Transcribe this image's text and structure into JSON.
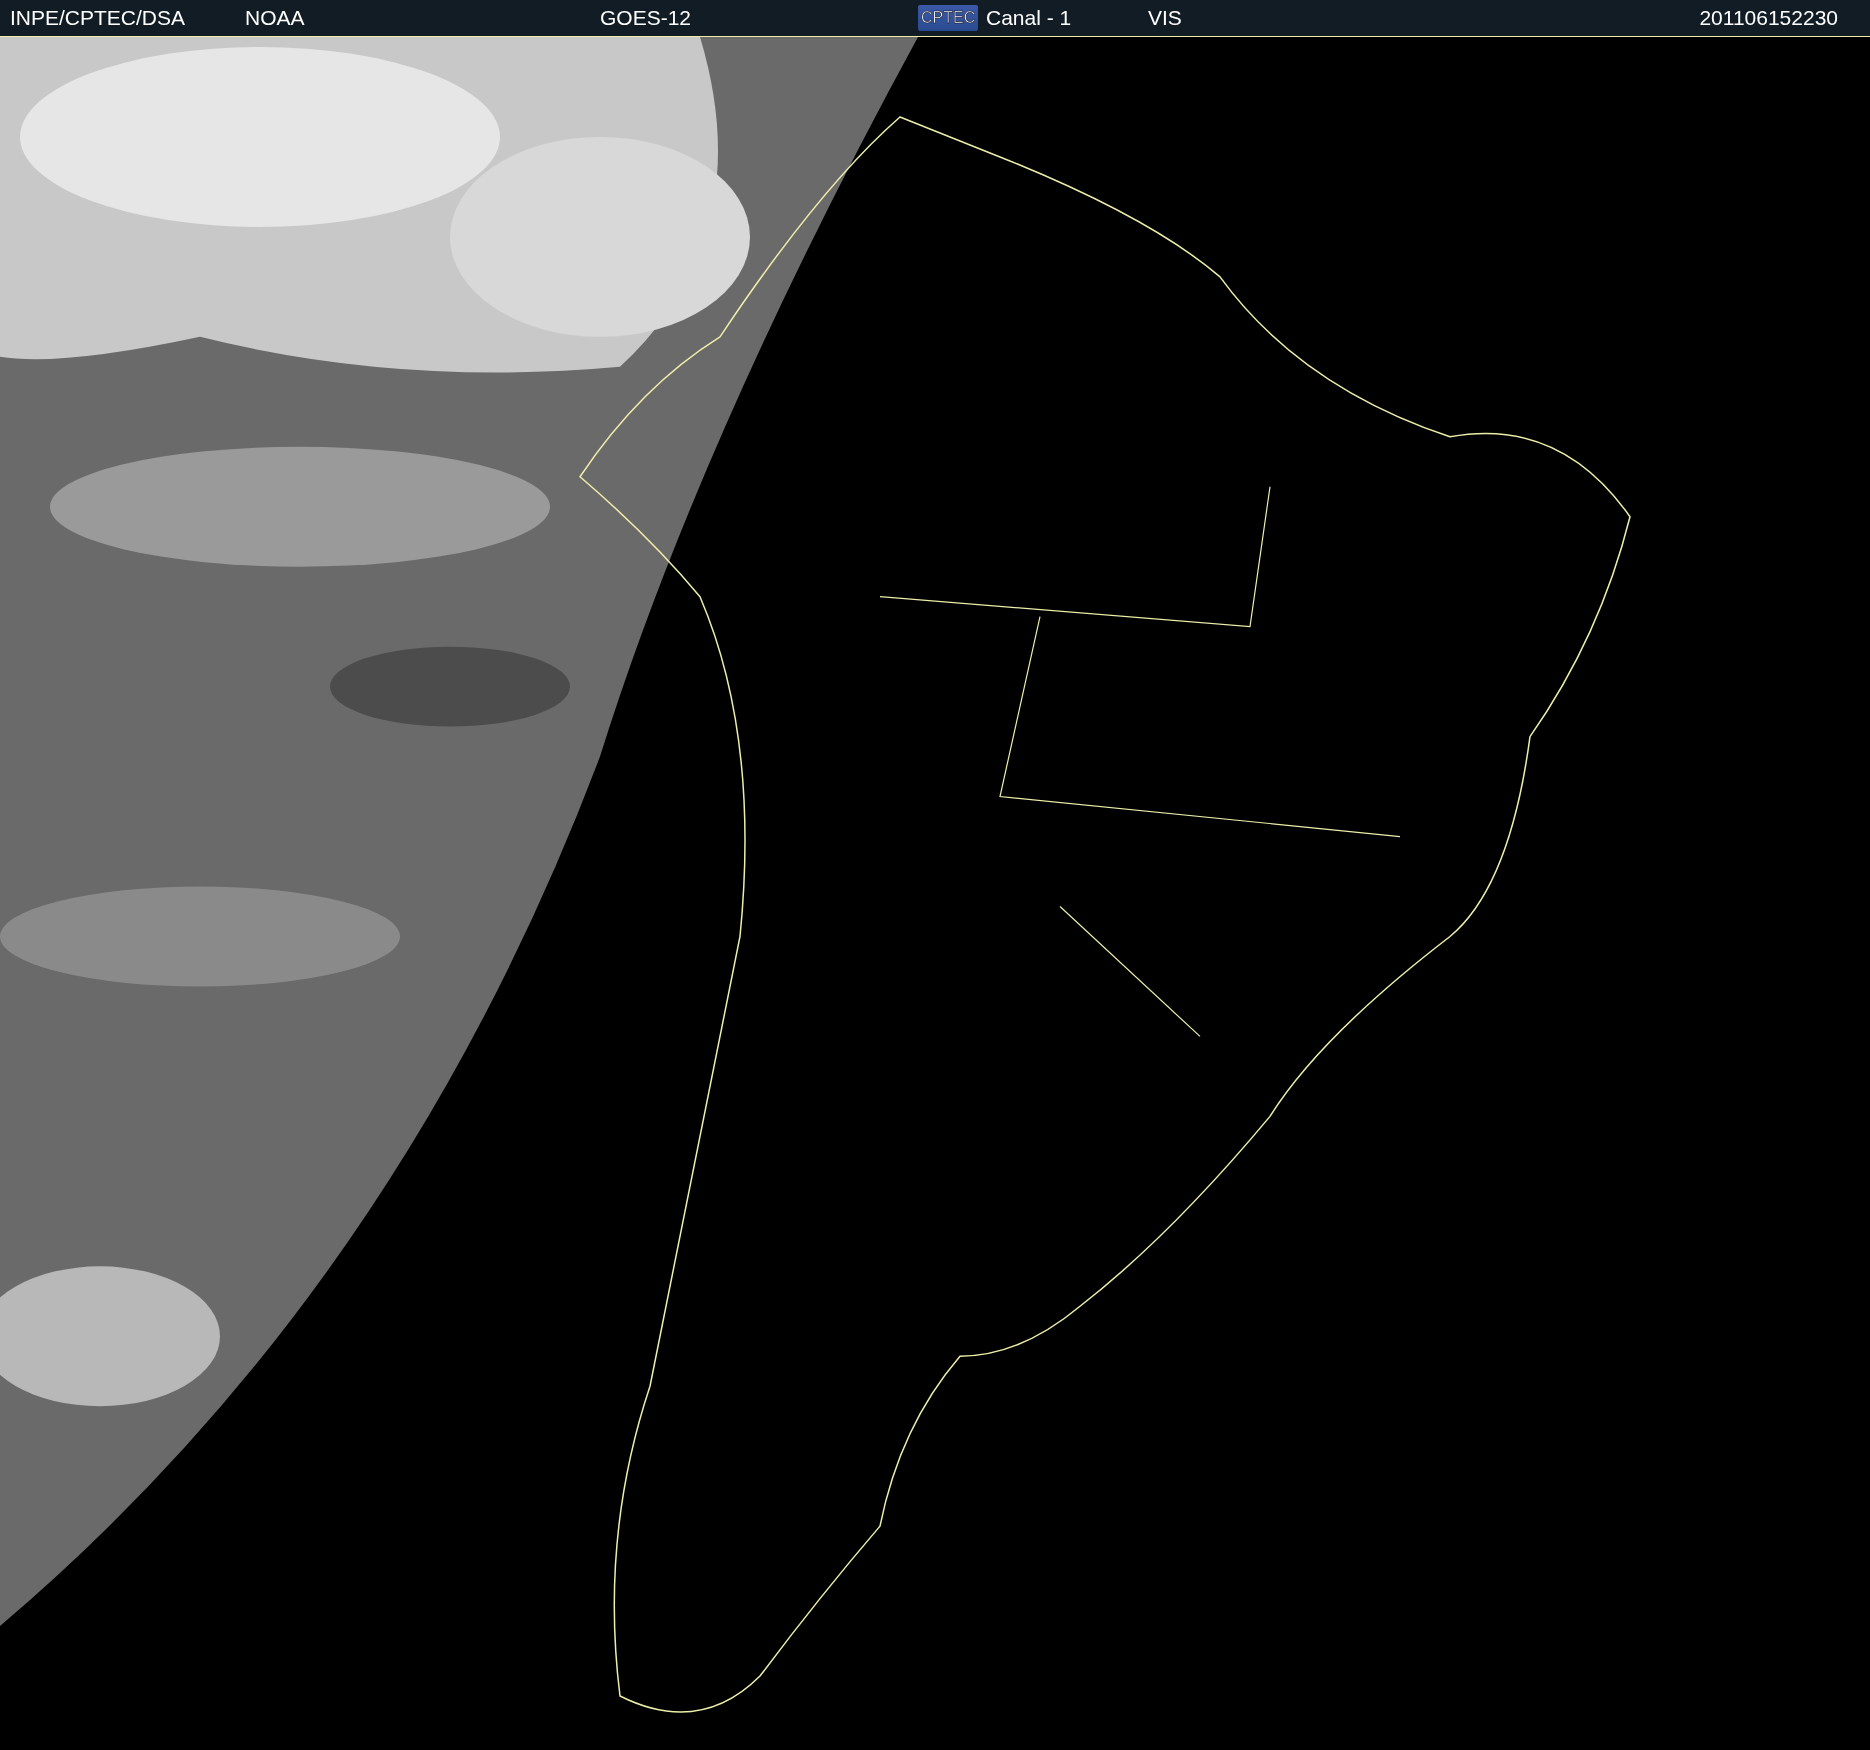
{
  "header": {
    "source": "INPE/CPTEC/DSA",
    "agency": "NOAA",
    "satellite": "GOES-12",
    "logo_text": "CPTEC",
    "channel": "Canal - 1",
    "band": "VIS",
    "timestamp": "201106152230"
  }
}
